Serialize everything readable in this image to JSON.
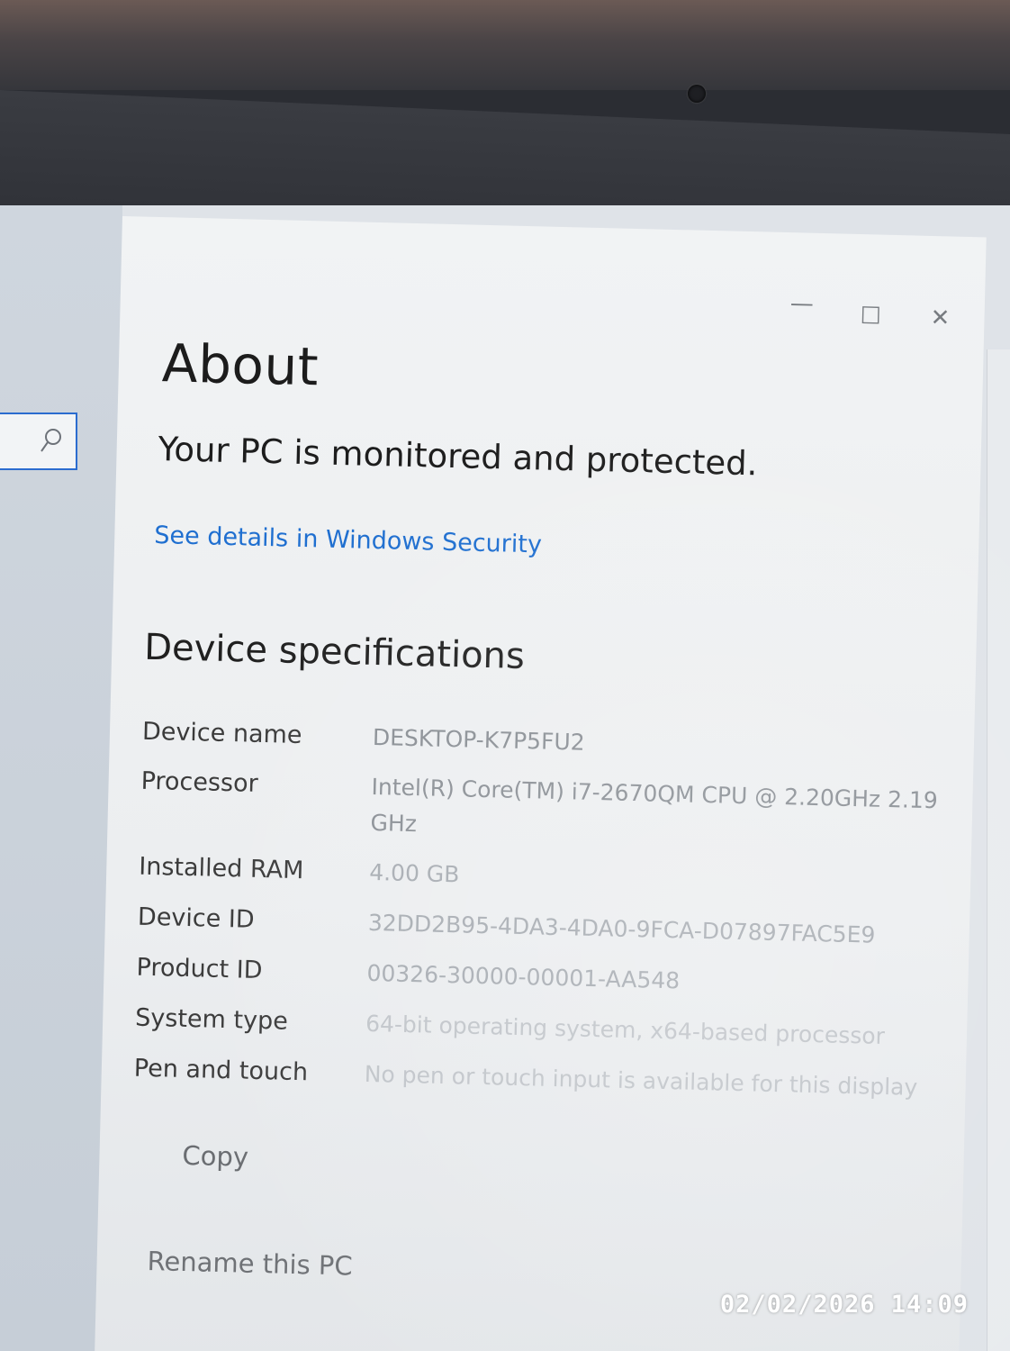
{
  "window": {
    "minimize_glyph": "—",
    "maximize_glyph": "☐",
    "close_glyph": "✕"
  },
  "page": {
    "title": "About"
  },
  "security": {
    "status": "Your PC is monitored and protected.",
    "link": "See details in Windows Security"
  },
  "device_specs": {
    "heading": "Device specifications",
    "rows": [
      {
        "label": "Device name",
        "value": "DESKTOP-K7P5FU2"
      },
      {
        "label": "Processor",
        "value": "Intel(R) Core(TM) i7-2670QM CPU @ 2.20GHz   2.19 GHz"
      },
      {
        "label": "Installed RAM",
        "value": "4.00 GB"
      },
      {
        "label": "Device ID",
        "value": "32DD2B95-4DA3-4DA0-9FCA-D07897FAC5E9"
      },
      {
        "label": "Product ID",
        "value": "00326-30000-00001-AA548"
      },
      {
        "label": "System type",
        "value": "64-bit operating system, x64-based processor"
      },
      {
        "label": "Pen and touch",
        "value": "No pen or touch input is available for this display"
      }
    ],
    "copy_label": "Copy"
  },
  "actions": {
    "rename_label": "Rename this PC"
  },
  "photo": {
    "timestamp": "02/02/2026  14:09"
  },
  "colors": {
    "link": "#1f6fd0",
    "search_border": "#2b6ccf"
  },
  "icons": {
    "search": "search-icon"
  }
}
